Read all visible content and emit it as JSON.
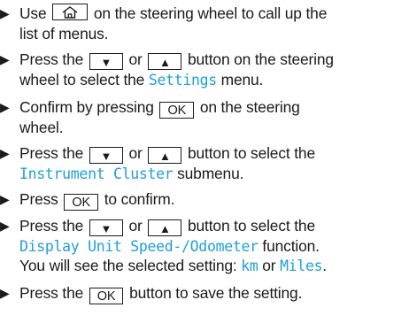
{
  "steps": [
    {
      "lines": [
        [
          "Use "
        ],
        [
          "on the steering wheel to call up the"
        ],
        [
          "list of menus."
        ]
      ]
    },
    {
      "t1": "Press the ",
      "t2": " or ",
      "t3": " button on the steering",
      "t4": "wheel to select the ",
      "d1": "Settings",
      "t5": " menu."
    },
    {
      "t1": "Confirm by pressing ",
      "t2": " on the steering",
      "t3": "wheel."
    },
    {
      "t1": "Press the ",
      "t2": " or ",
      "t3": " button to select the",
      "d1": "Instrument Cluster",
      "t4": " submenu."
    },
    {
      "t1": "Press ",
      "t2": " to confirm."
    },
    {
      "t1": "Press the ",
      "t2": " or ",
      "t3": " button to select the",
      "d1": "Display Unit Speed-/Odometer",
      "t4": " function.",
      "t5": "You will see the selected setting: ",
      "d2": "km",
      "t6": " or ",
      "d3": "Miles",
      "t7": "."
    },
    {
      "t1": "Press the ",
      "t2": " button to save the setting."
    }
  ],
  "keys": {
    "down": "▼",
    "up": "▲",
    "ok": "OK",
    "home_icon": "home-icon"
  },
  "bullet": "▶"
}
